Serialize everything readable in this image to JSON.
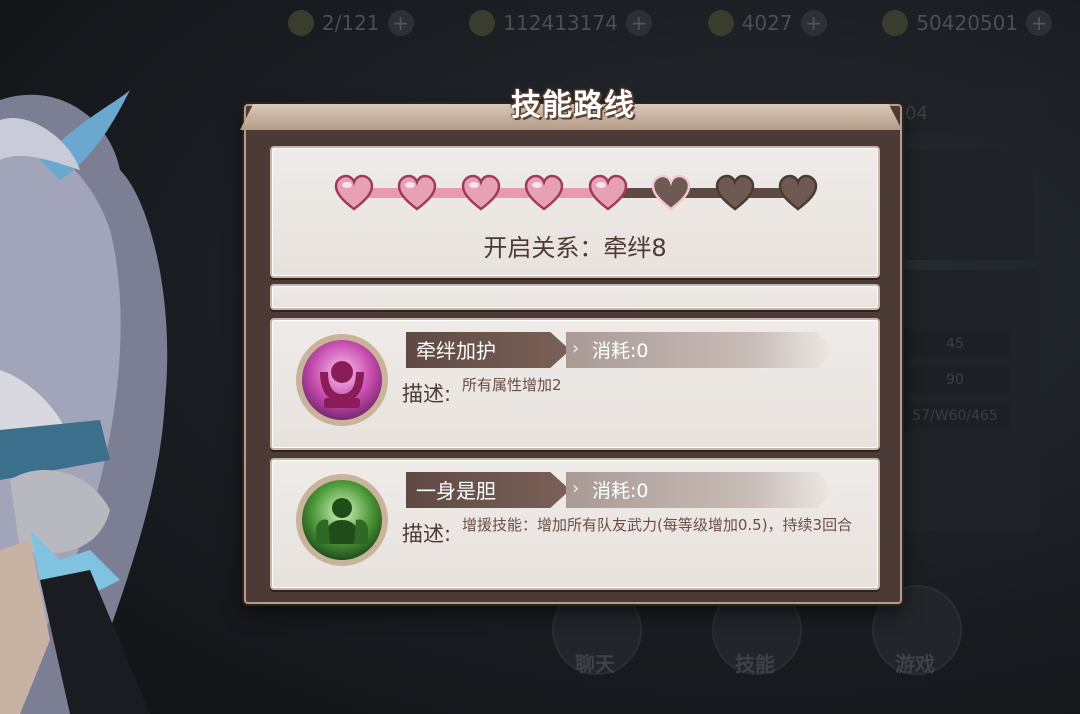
{
  "background": {
    "resources": [
      {
        "icon": "energy-icon",
        "value": "2/121"
      },
      {
        "icon": "gold-coin-icon",
        "value": "112413174"
      },
      {
        "icon": "gem-icon",
        "value": "4027"
      },
      {
        "icon": "leaf-currency-icon",
        "value": "50420501"
      }
    ],
    "side_values": [
      "04",
      "45",
      "90",
      "57/W60/465"
    ],
    "nav": [
      {
        "label": "聊天",
        "icon": "chat-icon"
      },
      {
        "label": "技能",
        "icon": "skill-icon"
      },
      {
        "label": "游戏",
        "icon": "game-icon"
      }
    ]
  },
  "dialog": {
    "title": "技能路线",
    "bond_progress": {
      "filled": 5,
      "total": 8,
      "fill_color": "#e8a0b4",
      "empty_color": "#6e5a52"
    },
    "unlock_text": "开启关系：牵绊8",
    "skills": [
      {
        "name": "牵绊加护",
        "cost": "消耗:0",
        "desc_label": "描述:",
        "desc": "所有属性增加2",
        "icon": "bond-guard-icon",
        "icon_color": "#c94fb0"
      },
      {
        "name": "一身是胆",
        "cost": "消耗:0",
        "desc_label": "描述:",
        "desc": "增援技能：增加所有队友武力(每等级增加0.5)，持续3回合",
        "icon": "bravery-icon",
        "icon_color": "#4f9a3a"
      }
    ]
  },
  "colors": {
    "dialog_frame": "#b89c87",
    "card_bg": "#ece7e3",
    "text_brown": "#4e3a32"
  }
}
